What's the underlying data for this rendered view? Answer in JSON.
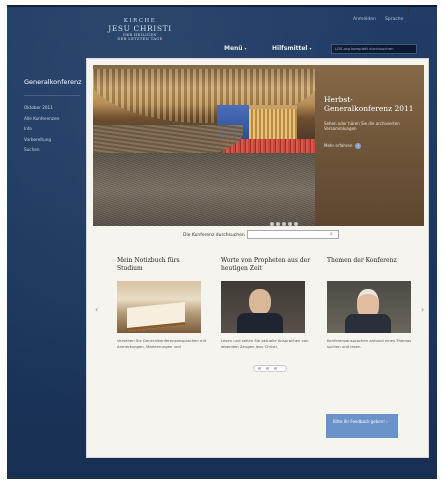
{
  "header": {
    "logo": {
      "line1": "KIRCHE",
      "line2": "JESU CHRISTI",
      "line3a": "DER HEILIGEN",
      "line3b": "DER LETZTEN TAGE"
    },
    "utility": {
      "signin": "Anmelden",
      "language": "Sprache"
    },
    "nav": {
      "menu": "Menü",
      "help": "Hilfsmittel",
      "caret": "▾"
    },
    "search_placeholder": "LDS.org komplett durchsuchen"
  },
  "sidebar": {
    "title": "Generalkonferenz",
    "items": [
      "Oktober 2011",
      "Alle Konferenzen",
      "Info",
      "Vorbereitung",
      "Suchen"
    ]
  },
  "hero": {
    "headline": "Herbst-Generalkonferenz 2011",
    "body": "Sehen oder hören Sie die archivierten Versammlungen",
    "link": "Mehr erfahren",
    "link_arrow": "›",
    "dot_count": 5
  },
  "conference_search": {
    "label": "Die Konferenz durchsuchen",
    "button": "⌕"
  },
  "features": {
    "cards": [
      {
        "title": "Mein Notizbuch fürs Studium",
        "desc": "Versehen Sie Generalkonferenzansprachen mit Anmerkungen, Markierungen und"
      },
      {
        "title": "Worte von Propheten aus der heutigen Zeit",
        "desc": "Lesen und sehen Sie aktuelle Ansprachen von lebenden Zeugen Jesu Christi."
      },
      {
        "title": "Themen der Konferenz",
        "desc": "Konferenzansprachen anhand eines Themas suchen und lesen."
      }
    ],
    "prev": "‹",
    "next": "›"
  },
  "feedback": {
    "label": "Bitte Ihr Feedback geben! ›"
  }
}
